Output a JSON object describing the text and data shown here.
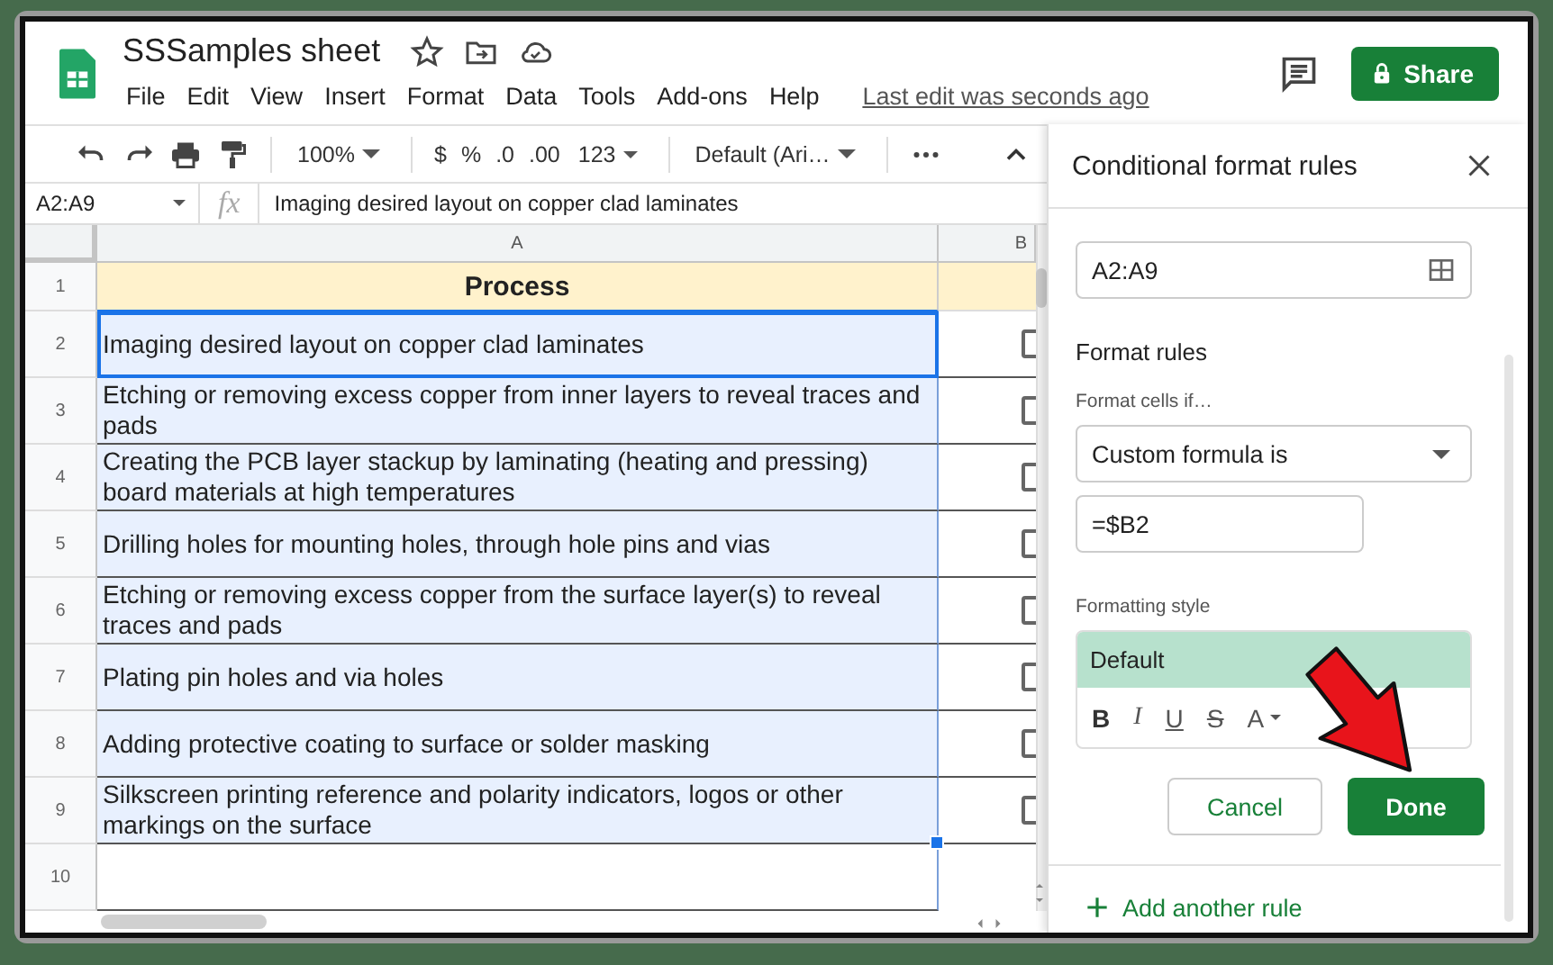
{
  "window": {
    "title": "SSSamples sheet"
  },
  "menu": [
    "File",
    "Edit",
    "View",
    "Insert",
    "Format",
    "Data",
    "Tools",
    "Add-ons",
    "Help"
  ],
  "last_edit": "Last edit was seconds ago",
  "share_button": "Share",
  "toolbar": {
    "zoom": "100%",
    "currency": "$",
    "percent": "%",
    "decrease_decimals": ".0",
    "increase_decimals": ".00",
    "number_format": "123",
    "font": "Default (Ari…"
  },
  "formula_bar": {
    "name_box": "A2:A9",
    "fx": "fx",
    "value": "Imaging desired layout on copper clad laminates"
  },
  "sheet": {
    "columns": [
      "A",
      "B"
    ],
    "header_row": {
      "number": "1",
      "text": "Process"
    },
    "rows": [
      {
        "number": "2",
        "text": "Imaging desired layout on copper clad laminates",
        "selected": true,
        "active": true,
        "checked": false
      },
      {
        "number": "3",
        "text": "Etching or removing excess copper from inner layers to reveal traces and pads",
        "selected": true,
        "active": false,
        "checked": false
      },
      {
        "number": "4",
        "text": "Creating the PCB layer stackup by laminating (heating and pressing) board materials at high temperatures",
        "selected": true,
        "active": false,
        "checked": false
      },
      {
        "number": "5",
        "text": "Drilling holes for mounting holes, through hole pins and vias",
        "selected": true,
        "active": false,
        "checked": false
      },
      {
        "number": "6",
        "text": "Etching or removing excess copper from the surface layer(s) to reveal traces and pads",
        "selected": true,
        "active": false,
        "checked": false
      },
      {
        "number": "7",
        "text": "Plating pin holes and via holes",
        "selected": true,
        "active": false,
        "checked": false
      },
      {
        "number": "8",
        "text": "Adding protective coating to surface or solder masking",
        "selected": true,
        "active": false,
        "checked": false
      },
      {
        "number": "9",
        "text": "Silkscreen printing reference and polarity indicators, logos or other markings on the surface",
        "selected": true,
        "active": false,
        "checked": false
      }
    ],
    "empty_rows": [
      "10"
    ]
  },
  "panel": {
    "title": "Conditional format rules",
    "range": "A2:A9",
    "section_title": "Format rules",
    "condition_label": "Format cells if…",
    "condition": "Custom formula is",
    "formula": "=$B2",
    "style_label": "Formatting style",
    "style_preview": "Default",
    "style_buttons": [
      {
        "kind": "bold",
        "label": "B"
      },
      {
        "kind": "italic",
        "label": "I"
      },
      {
        "kind": "underline",
        "label": "U"
      },
      {
        "kind": "strikethrough",
        "label": "S"
      },
      {
        "kind": "text_color",
        "label": "A"
      }
    ],
    "cancel_button": "Cancel",
    "done_button": "Done",
    "add_rule": "Add another rule"
  }
}
